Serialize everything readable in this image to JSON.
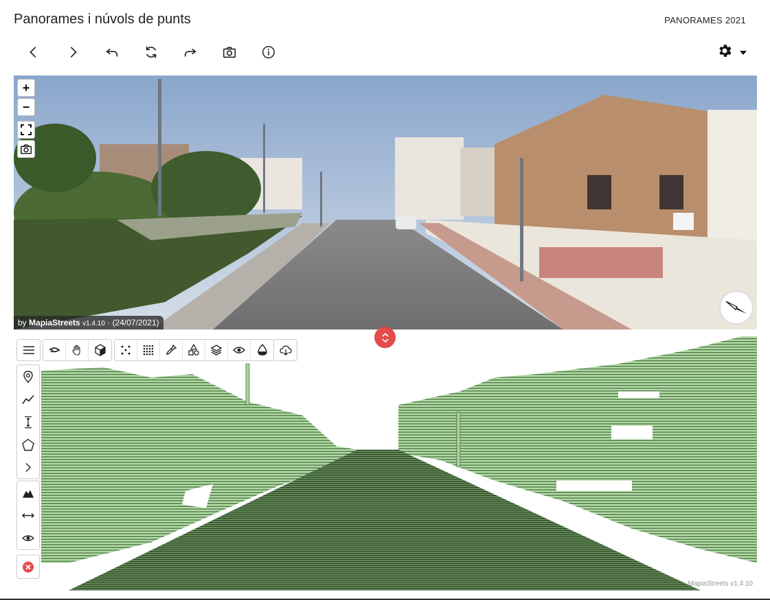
{
  "header": {
    "title": "Panorames i núvols de punts",
    "subtitle": "PANORAMES 2021"
  },
  "nav_buttons": [
    {
      "name": "previous",
      "icon": "chevron-left-icon"
    },
    {
      "name": "next",
      "icon": "chevron-right-icon"
    },
    {
      "name": "back",
      "icon": "undo-arrow-icon"
    },
    {
      "name": "refresh",
      "icon": "refresh-icon"
    },
    {
      "name": "forward",
      "icon": "redo-arrow-icon"
    },
    {
      "name": "capture",
      "icon": "camera-icon"
    },
    {
      "name": "info",
      "icon": "info-icon"
    }
  ],
  "settings": {
    "icon": "gear-icon",
    "caret": "caret-down-icon"
  },
  "panorama": {
    "controls": {
      "zoom_in": "+",
      "zoom_out": "−"
    },
    "attribution": {
      "prefix": "by",
      "brand": "MapiaStreets",
      "version": "v1.4.10",
      "date": "· (24/07/2021)"
    },
    "compass_icon": "compass-icon"
  },
  "viewer": {
    "watermark": "MapiaStreets v1.4.10",
    "cloud_color": "#a8d49c"
  },
  "colors": {
    "accent_red": "#e44b4b"
  }
}
